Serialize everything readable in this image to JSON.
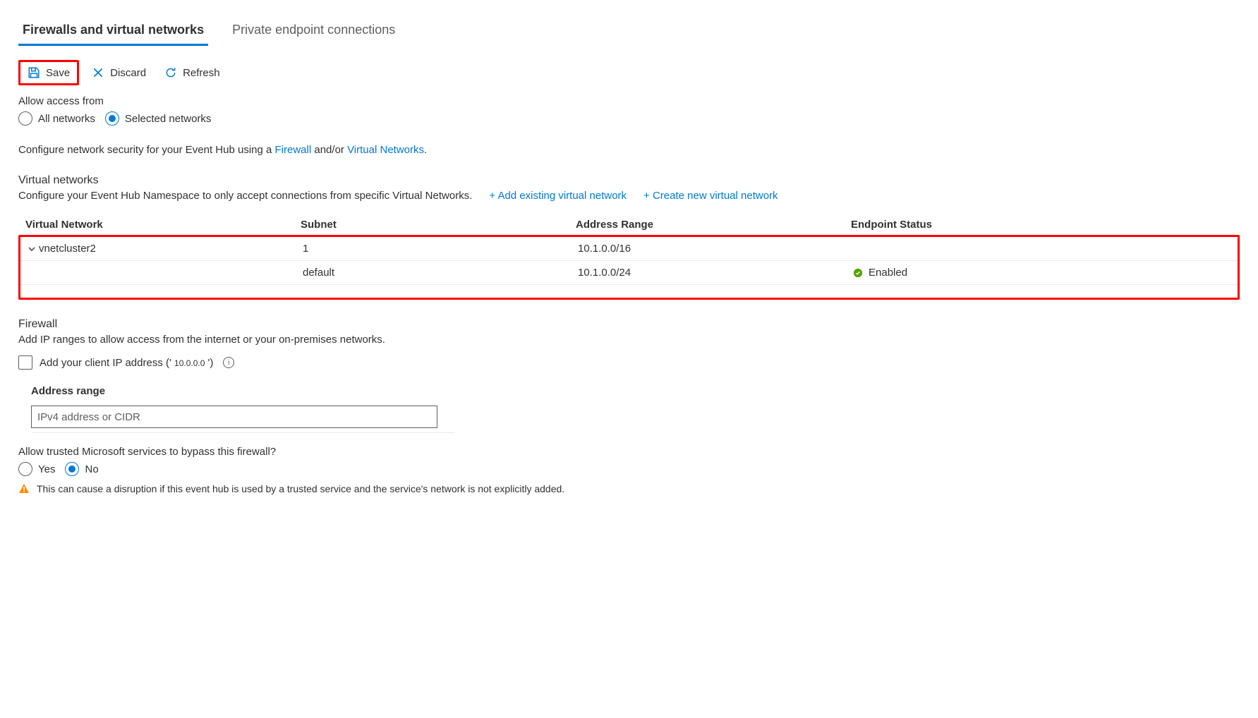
{
  "tabs": {
    "firewalls": "Firewalls and virtual networks",
    "private_ep": "Private endpoint connections"
  },
  "toolbar": {
    "save": "Save",
    "discard": "Discard",
    "refresh": "Refresh"
  },
  "access": {
    "label": "Allow access from",
    "all": "All networks",
    "selected": "Selected networks"
  },
  "desc": {
    "prefix": "Configure network security for your Event Hub using a ",
    "link1": "Firewall",
    "middle": " and/or ",
    "link2": "Virtual Networks",
    "suffix": "."
  },
  "vnet": {
    "heading": "Virtual networks",
    "subtext": "Configure your Event Hub Namespace to only accept connections from specific Virtual Networks.",
    "add_existing": "+ Add existing virtual network",
    "create_new": "+ Create new virtual network",
    "headers": {
      "name": "Virtual Network",
      "subnet": "Subnet",
      "range": "Address Range",
      "status": "Endpoint Status"
    },
    "rows": [
      {
        "name": "vnetcluster2",
        "subnet": "1",
        "range": "10.1.0.0/16",
        "status": ""
      },
      {
        "name": "",
        "subnet": "default",
        "range": "10.1.0.0/24",
        "status": "Enabled"
      }
    ]
  },
  "firewall": {
    "heading": "Firewall",
    "subtext": "Add IP ranges to allow access from the internet or your on-premises networks.",
    "add_client_prefix": "Add your client IP address (' ",
    "client_ip": "10.0.0.0",
    "add_client_suffix": " ')",
    "addr_label": "Address range",
    "addr_placeholder": "IPv4 address or CIDR"
  },
  "bypass": {
    "label": "Allow trusted Microsoft services to bypass this firewall?",
    "yes": "Yes",
    "no": "No",
    "warning": "This can cause a disruption if this event hub is used by a trusted service and the service's network is not explicitly added."
  }
}
